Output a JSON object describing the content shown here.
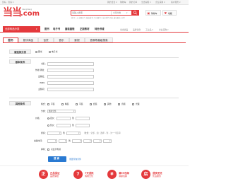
{
  "topbar": {
    "left_text": "您好，您好 ▾",
    "right_links": [
      "我的当当 ▾",
      "购物车",
      "我的订单",
      "当当客服 ▾",
      "企业采购 ▾",
      "客户服务 ▾"
    ]
  },
  "logo": {
    "text": "当当.com",
    "subtitle": "dangdang"
  },
  "search": {
    "placeholder": "请输入搜索",
    "category": "全部分类",
    "button_icon": "search-icon",
    "hot_words": "热门：二十四节气  当当读书  少儿图书  小说  文学  历史  成功励志  艺术"
  },
  "header_right": {
    "links": [
      "购物车",
      "收藏"
    ]
  },
  "nav": {
    "category_button": "全部商品分类",
    "items": [
      "图书",
      "电子书",
      "童装童鞋",
      "正版教材",
      "特色书城"
    ],
    "right_links": [
      "当当优品",
      "品牌直供",
      "工业品 ▾",
      "企业采购 ▾"
    ]
  },
  "tabs": [
    "图书",
    "数字商品",
    "百货",
    "音乐",
    "影视",
    "音像等高级搜索"
  ],
  "search_type": {
    "label": "请选择分类",
    "options": [
      "图书",
      "电子书"
    ],
    "selected": 0
  },
  "basic": {
    "title": "基本条件",
    "fields": [
      "书名：",
      "作者/译者：",
      "出版社：",
      "ISBN：",
      "主题词："
    ]
  },
  "other": {
    "title": "其他条件",
    "format_label": "格式：",
    "formats": [
      "平装",
      "精装",
      "平装",
      "套装",
      "其他",
      "音频",
      "光碟"
    ],
    "category_label": "分类：",
    "category_value": "图书全部",
    "price_label": "价格：",
    "price_opt1": "定价：",
    "price_opt2": "售价：",
    "price_sep": "到",
    "discount_label": "折扣：",
    "discount_note": "（数量：全部，如：选择 - 到 - 为一个区间）",
    "date_label": "出版时间：",
    "date_sep": "到",
    "stock_label": "库存：",
    "stock_opt": "只显示有货"
  },
  "submit": {
    "label": "搜 索",
    "reset": "重置查询条件"
  },
  "promos": [
    {
      "icon": "正",
      "line1": "正品保证",
      "line2": "品质保障"
    },
    {
      "icon": "7",
      "line1": "7天退换",
      "line2": "购物无忧"
    },
    {
      "icon": "¥",
      "line1": "满99包邮",
      "line2": "满额包邮"
    },
    {
      "icon": "店",
      "line1": "退换无忧",
      "line2": "售后服务"
    }
  ]
}
